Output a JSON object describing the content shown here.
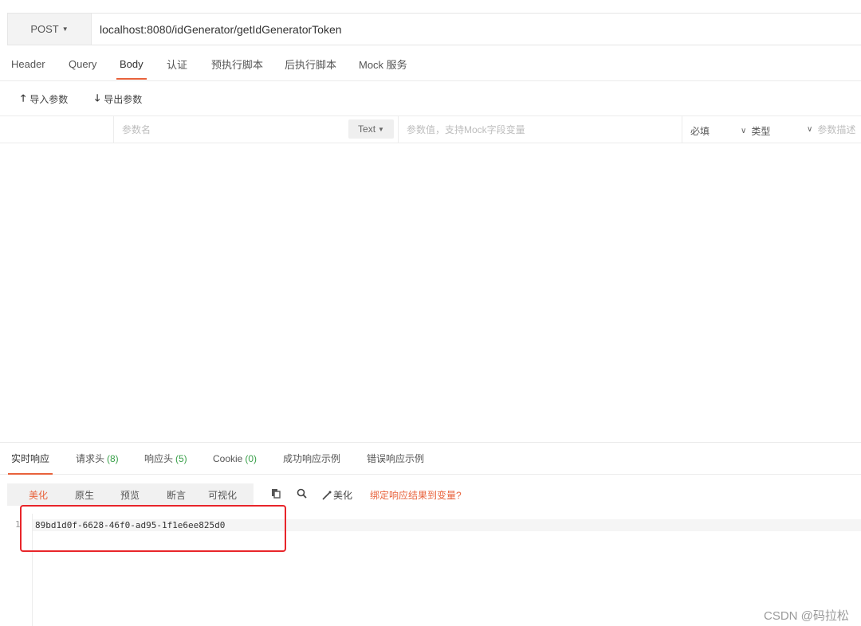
{
  "request": {
    "method": "POST",
    "url": "localhost:8080/idGenerator/getIdGeneratorToken"
  },
  "tabs": [
    {
      "label": "Header"
    },
    {
      "label": "Query"
    },
    {
      "label": "Body",
      "active": true
    },
    {
      "label": "认证"
    },
    {
      "label": "预执行脚本"
    },
    {
      "label": "后执行脚本"
    },
    {
      "label": "Mock 服务"
    }
  ],
  "toolbar": {
    "import_label": "导入参数",
    "export_label": "导出参数"
  },
  "params": {
    "name_placeholder": "参数名",
    "type_select": "Text",
    "value_placeholder": "参数值，支持Mock字段变量",
    "required_label": "必填",
    "type_label": "类型",
    "desc_placeholder": "参数描述"
  },
  "response": {
    "tabs": [
      {
        "label": "实时响应",
        "count": "",
        "active": true
      },
      {
        "label": "请求头",
        "count": "(8)"
      },
      {
        "label": "响应头",
        "count": "(5)"
      },
      {
        "label": "Cookie",
        "count": "(0)"
      },
      {
        "label": "成功响应示例",
        "count": ""
      },
      {
        "label": "错误响应示例",
        "count": ""
      }
    ],
    "view_buttons": [
      {
        "label": "美化",
        "active": true
      },
      {
        "label": "原生"
      },
      {
        "label": "预览"
      },
      {
        "label": "断言"
      },
      {
        "label": "可视化"
      }
    ],
    "beautify_label": "美化",
    "bind_link": "绑定响应结果到变量?",
    "line_number": "1",
    "body": "89bd1d0f-6628-46f0-ad95-1f1e6ee825d0"
  },
  "watermark": "CSDN @码拉松",
  "colors": {
    "accent": "#e8623b",
    "highlight_box": "#e8252a",
    "count_green": "#3aa04a"
  },
  "icons": [
    "caret-down-icon",
    "arrow-up-icon",
    "arrow-down-icon",
    "chevron-down-icon",
    "copy-icon",
    "search-icon",
    "magic-wand-icon"
  ]
}
